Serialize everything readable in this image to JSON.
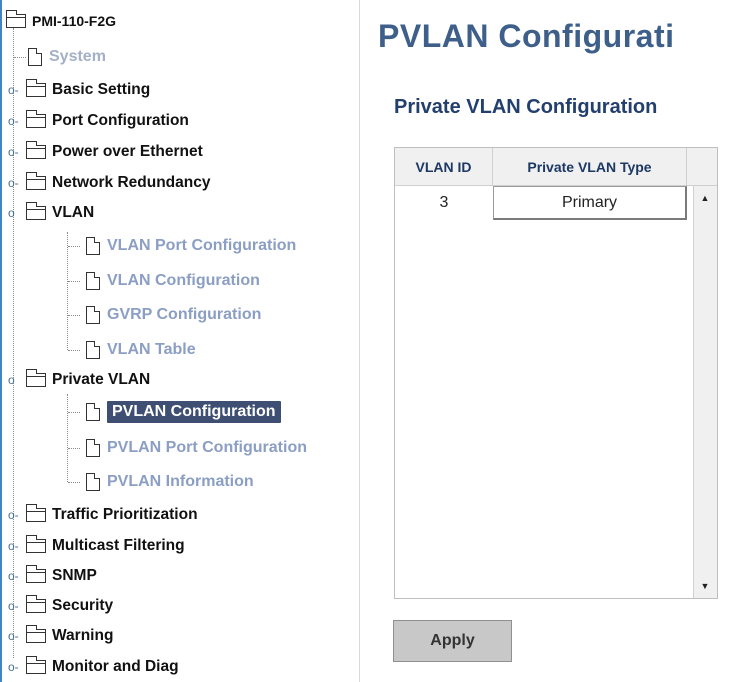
{
  "tree": {
    "root": "PMI-110-F2G",
    "system": "System",
    "folders": {
      "basic_setting": "Basic Setting",
      "port_configuration": "Port Configuration",
      "power_over_ethernet": "Power over Ethernet",
      "network_redundancy": "Network Redundancy",
      "vlan": "VLAN",
      "private_vlan": "Private VLAN",
      "traffic_prioritization": "Traffic Prioritization",
      "multicast_filtering": "Multicast Filtering",
      "snmp": "SNMP",
      "security": "Security",
      "warning": "Warning",
      "monitor_and_diag": "Monitor and Diag"
    },
    "vlan_children": {
      "vlan_port_configuration": "VLAN Port Configuration",
      "vlan_configuration": "VLAN Configuration",
      "gvrp_configuration": "GVRP Configuration",
      "vlan_table": "VLAN Table"
    },
    "pvlan_children": {
      "pvlan_configuration": "PVLAN Configuration",
      "pvlan_port_configuration": "PVLAN Port Configuration",
      "pvlan_information": "PVLAN Information"
    },
    "collapsed_glyph": "o-",
    "expanded_glyph": "o"
  },
  "main": {
    "page_title": "PVLAN Configurati",
    "section_title": "Private VLAN Configuration",
    "table": {
      "headers": {
        "vlan_id": "VLAN ID",
        "type": "Private VLAN Type"
      },
      "rows": [
        {
          "vlan_id": "3",
          "type": "Primary"
        }
      ]
    },
    "scroll_up": "▲",
    "scroll_down": "▼",
    "apply_label": "Apply"
  },
  "colors": {
    "selected_bg": "#3f4f73",
    "leaf_text": "#8b9ec3",
    "heading": "#3d5f8a"
  }
}
